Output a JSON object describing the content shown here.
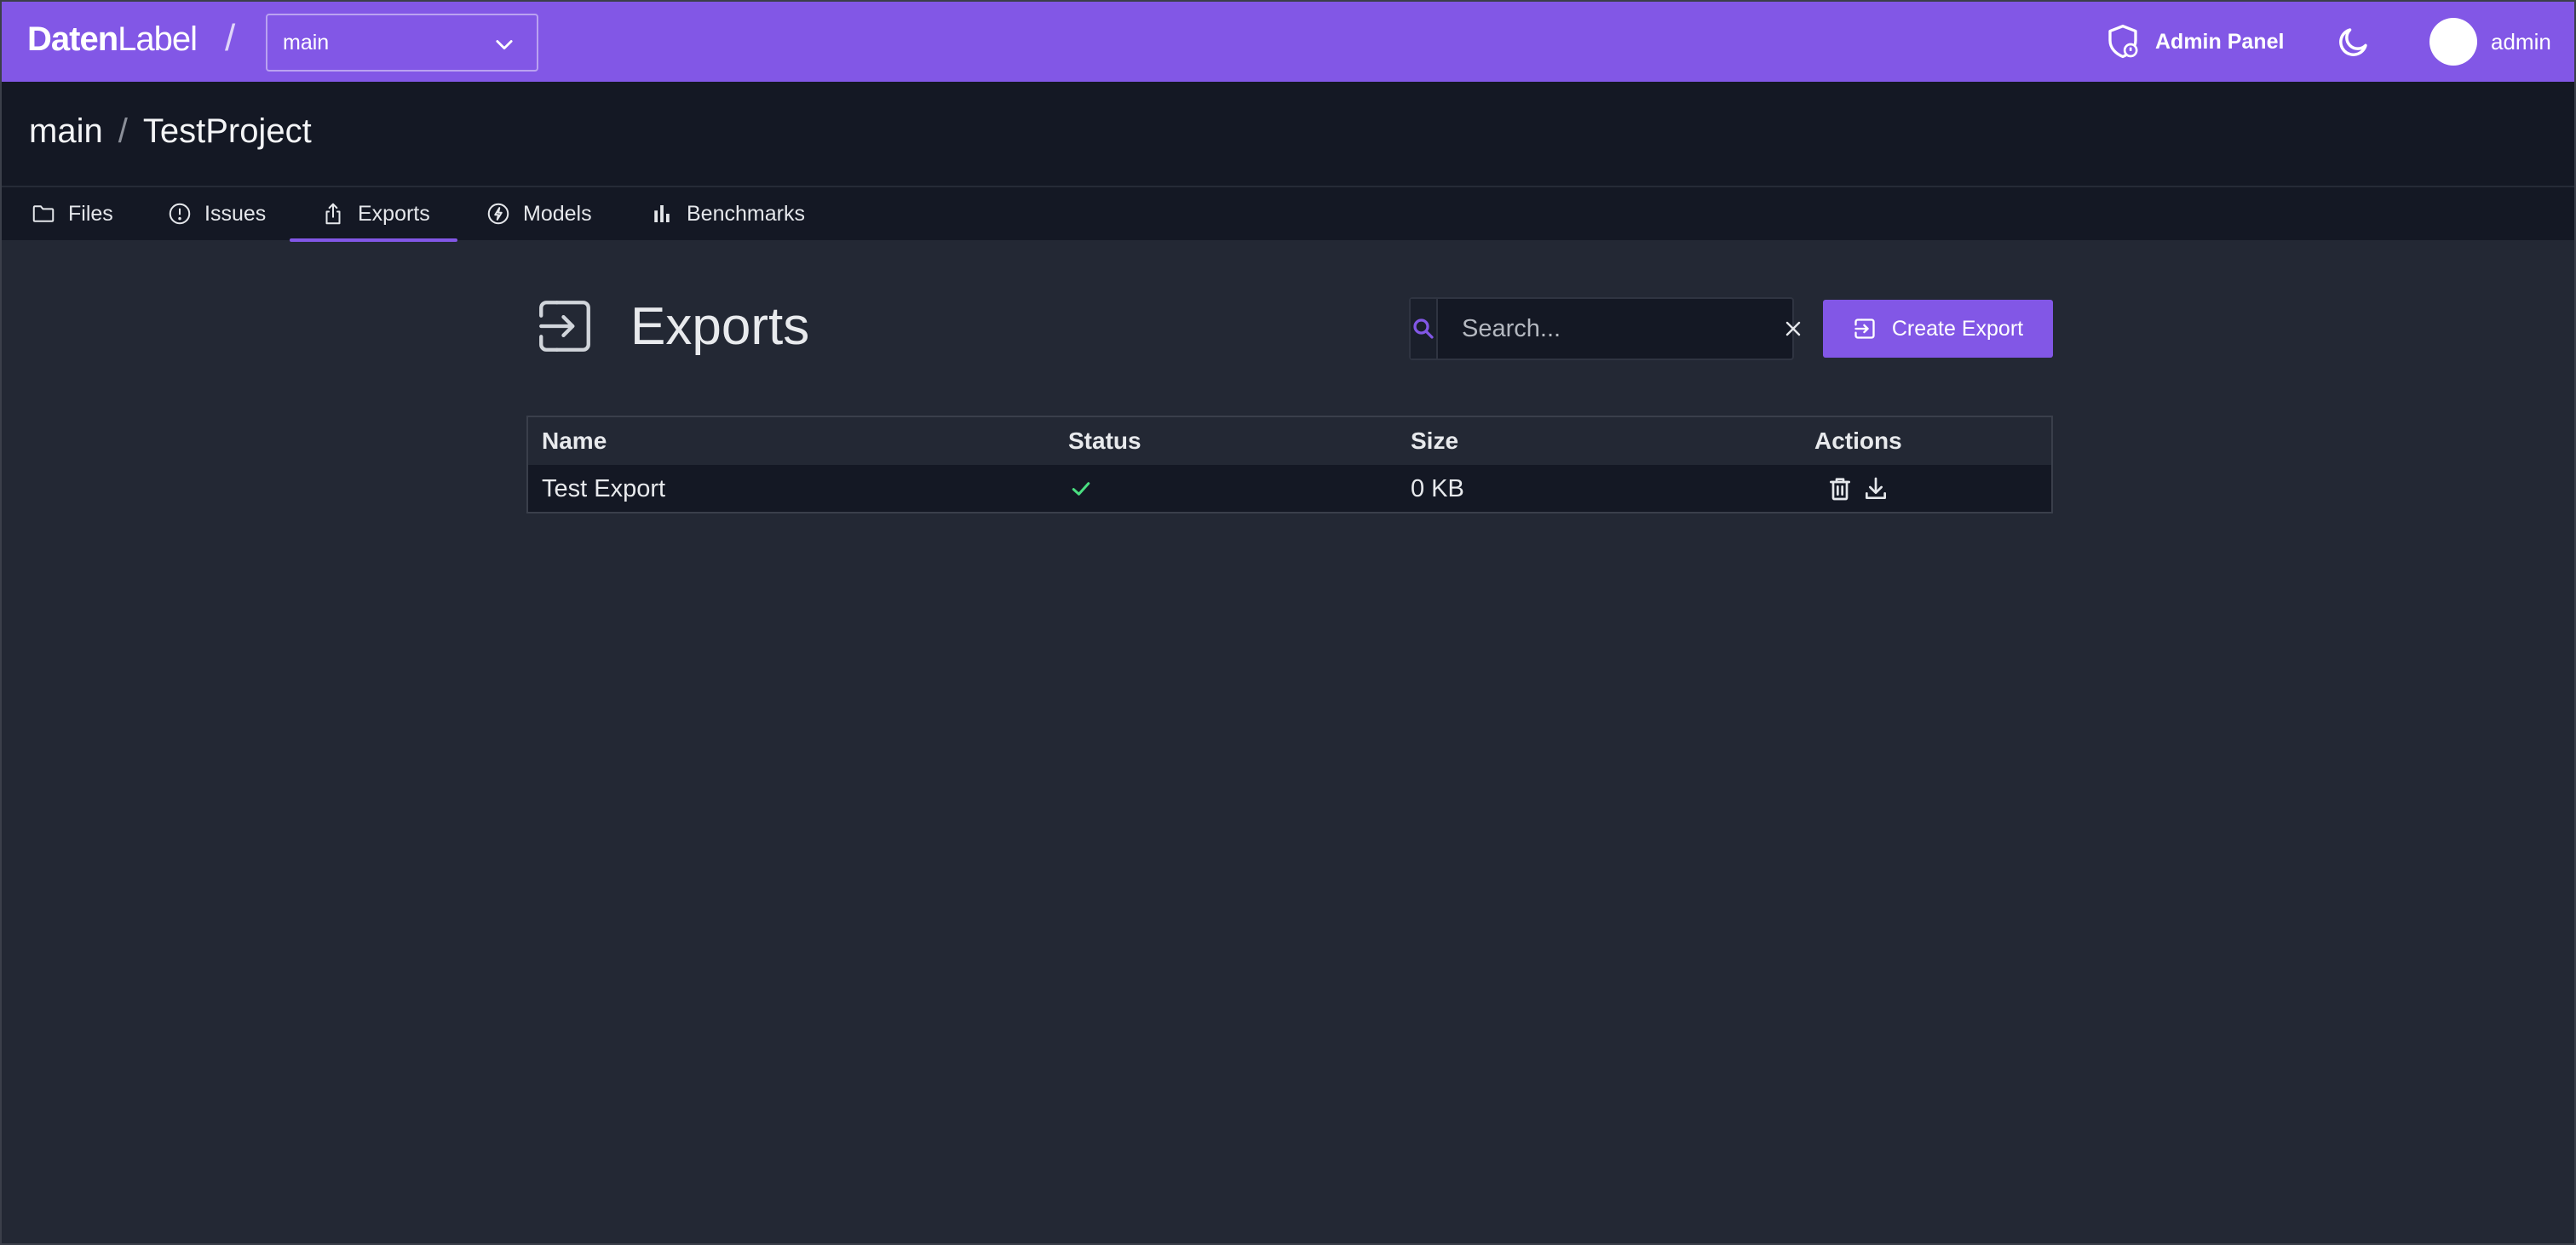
{
  "app": {
    "brand_bold": "Daten",
    "brand_light": "Label",
    "brand_separator": "/",
    "org_selected": "main"
  },
  "header_right": {
    "admin_panel_label": "Admin Panel",
    "username": "admin"
  },
  "breadcrumb": {
    "org": "main",
    "separator": "/",
    "project": "TestProject"
  },
  "tabs": [
    {
      "label": "Files",
      "icon": "folder-icon",
      "active": false
    },
    {
      "label": "Issues",
      "icon": "alert-circle-icon",
      "active": false
    },
    {
      "label": "Exports",
      "icon": "share-icon",
      "active": true
    },
    {
      "label": "Models",
      "icon": "bolt-icon",
      "active": false
    },
    {
      "label": "Benchmarks",
      "icon": "bar-chart-icon",
      "active": false
    }
  ],
  "page": {
    "title": "Exports",
    "icon": "export-icon"
  },
  "search": {
    "placeholder": "Search...",
    "value": ""
  },
  "create_button": {
    "label": "Create Export"
  },
  "table": {
    "columns": [
      "Name",
      "Status",
      "Size",
      "Actions"
    ],
    "rows": [
      {
        "name": "Test Export",
        "status": "complete",
        "size": "0 KB",
        "actions": [
          "delete",
          "download"
        ]
      }
    ]
  },
  "colors": {
    "accent": "#8257e6",
    "success": "#4ade80",
    "background": "#232834",
    "panel": "#141824"
  }
}
